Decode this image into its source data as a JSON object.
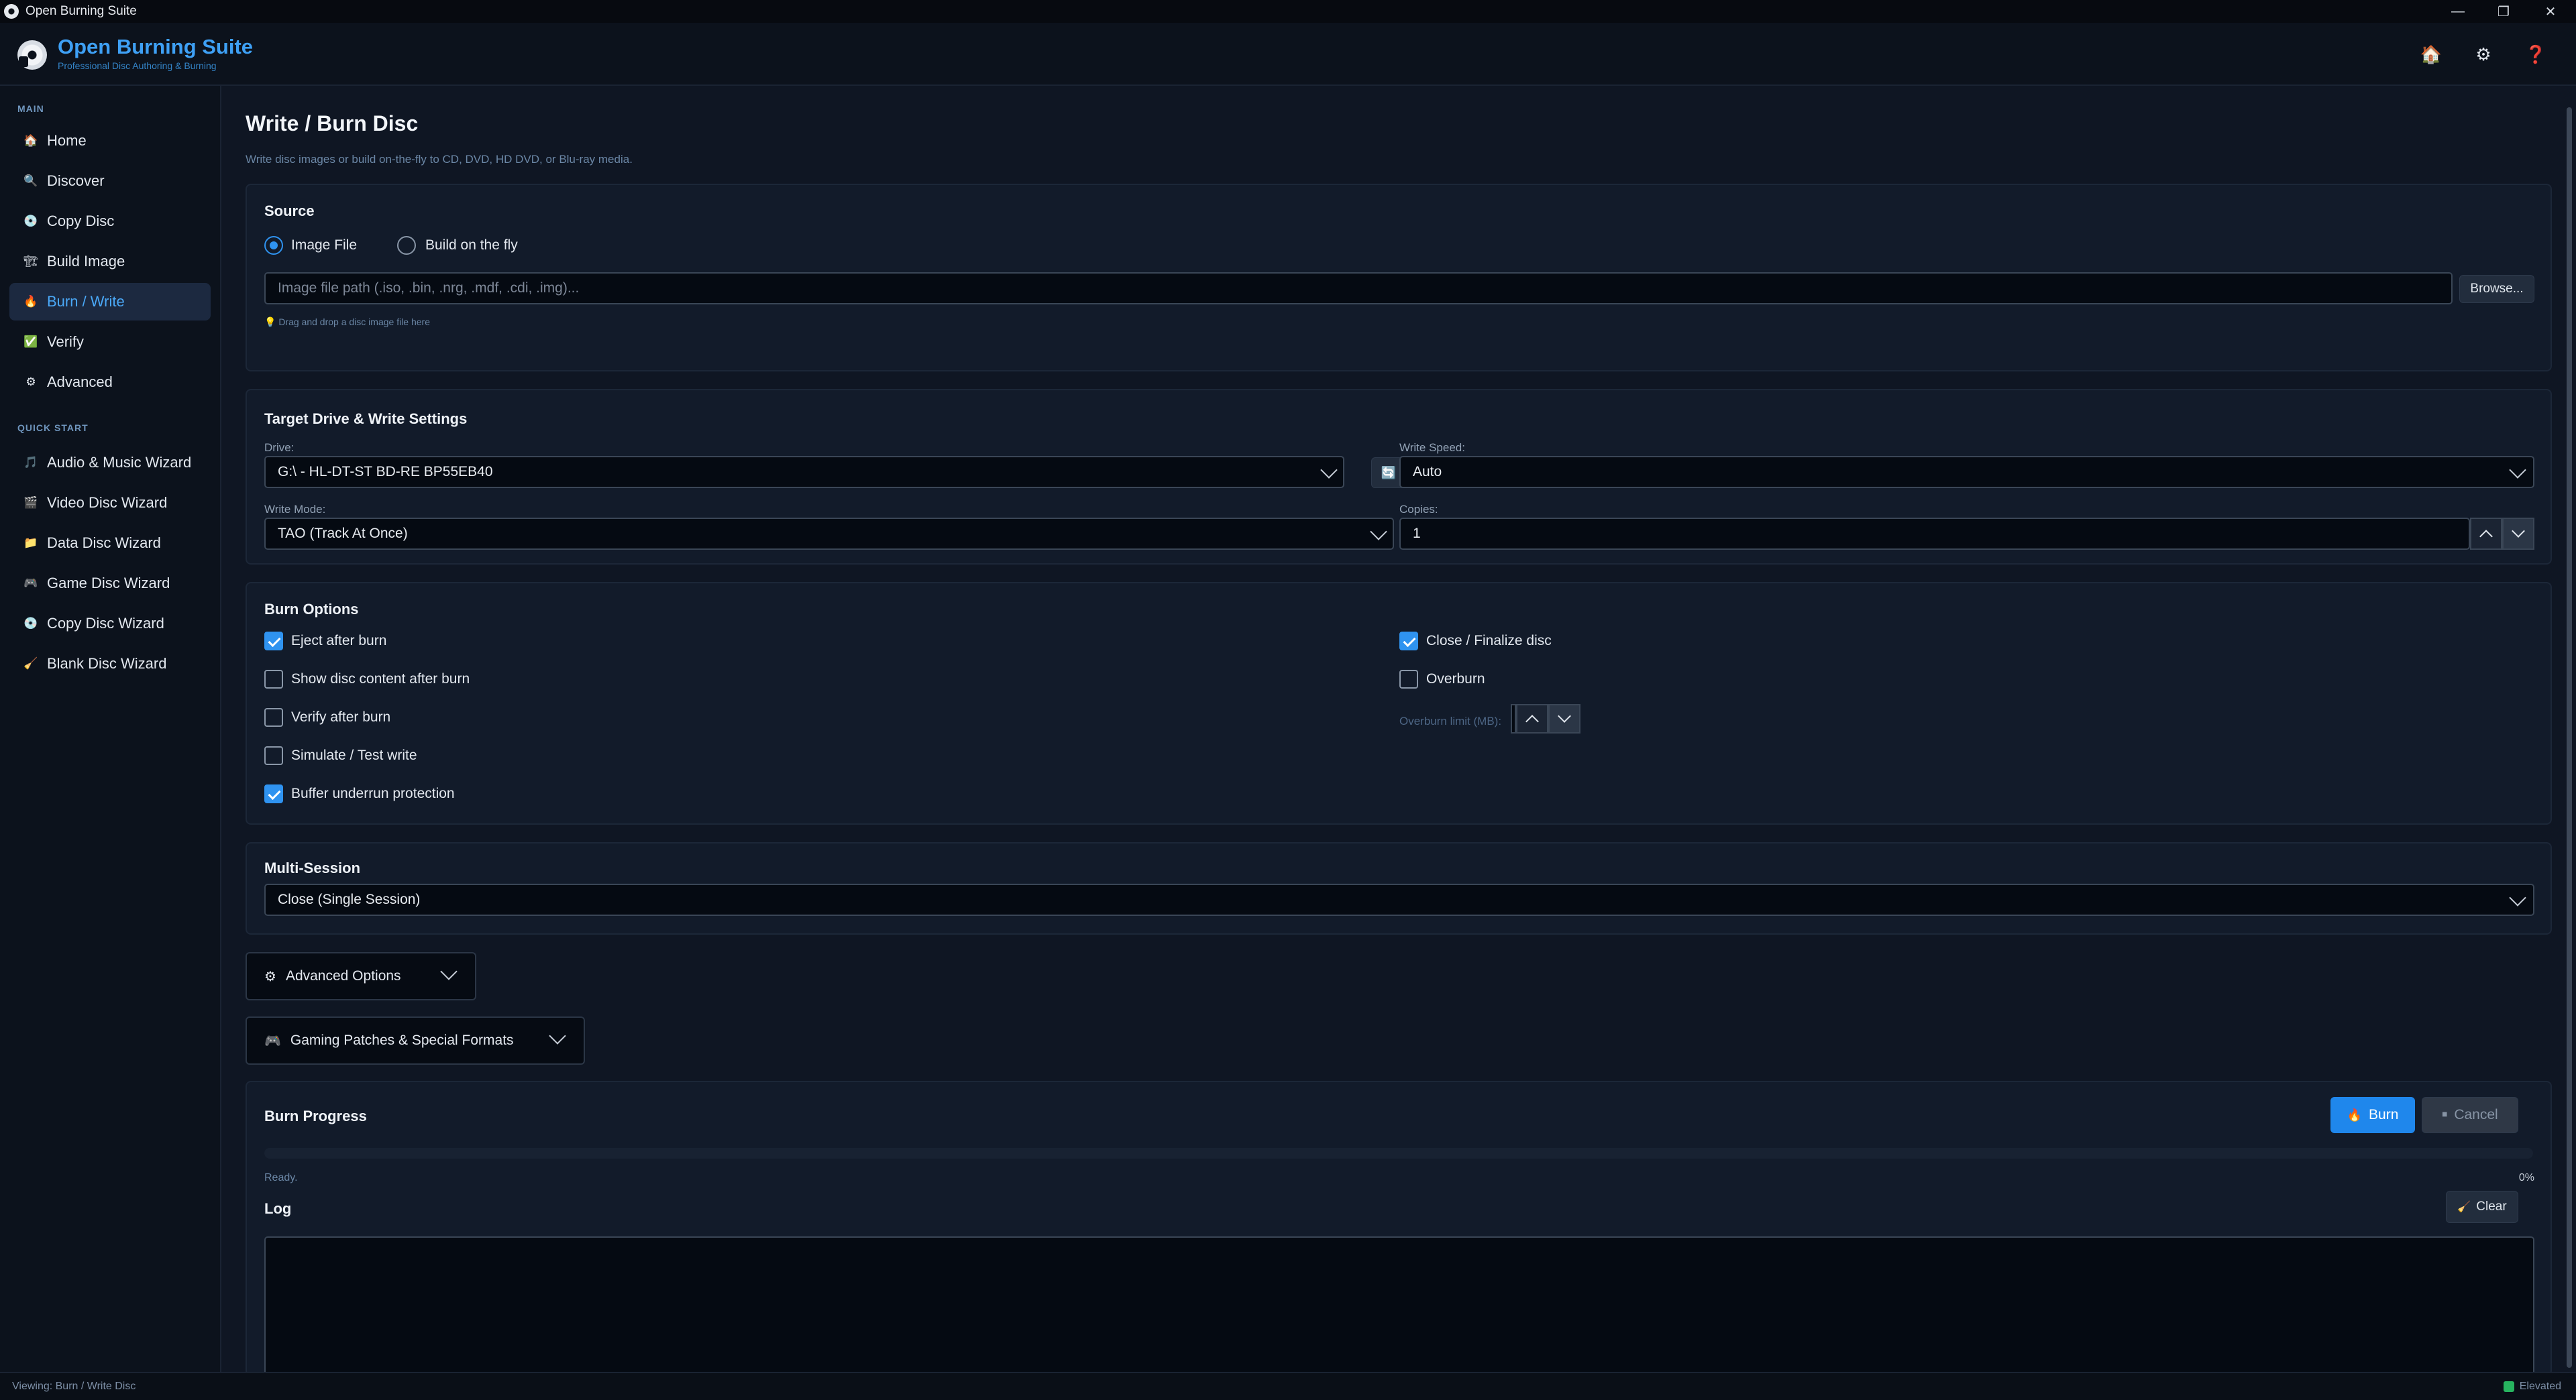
{
  "window": {
    "title": "Open Burning Suite",
    "minimize": "—",
    "maximize": "❐",
    "close": "✕"
  },
  "header": {
    "app_title": "Open Burning Suite",
    "subtitle": "Professional Disc Authoring & Burning",
    "home_icon": "🏠",
    "settings_icon": "⚙",
    "help_icon": "❓"
  },
  "sidebar": {
    "main_label": "MAIN",
    "main_items": [
      {
        "label": "Home",
        "icon": "🏠"
      },
      {
        "label": "Discover",
        "icon": "🔍"
      },
      {
        "label": "Copy Disc",
        "icon": "💿"
      },
      {
        "label": "Build Image",
        "icon": "🏗"
      },
      {
        "label": "Burn / Write",
        "icon": "🔥"
      },
      {
        "label": "Verify",
        "icon": "✅"
      },
      {
        "label": "Advanced",
        "icon": "⚙"
      }
    ],
    "quick_label": "QUICK START",
    "quick_items": [
      {
        "label": "Audio & Music Wizard",
        "icon": "🎵"
      },
      {
        "label": "Video Disc Wizard",
        "icon": "🎬"
      },
      {
        "label": "Data Disc Wizard",
        "icon": "📁"
      },
      {
        "label": "Game Disc Wizard",
        "icon": "🎮"
      },
      {
        "label": "Copy Disc Wizard",
        "icon": "💿"
      },
      {
        "label": "Blank Disc Wizard",
        "icon": "🧹"
      }
    ]
  },
  "page": {
    "title": "Write / Burn Disc",
    "subtitle": "Write disc images or build on-the-fly to CD, DVD, HD DVD, or Blu-ray media."
  },
  "source": {
    "title": "Source",
    "option_image": "Image File",
    "option_fly": "Build on the fly",
    "path_placeholder": "Image file path (.iso, .bin, .nrg, .mdf, .cdi, .img)...",
    "browse": "Browse...",
    "hint": "💡 Drag and drop a disc image file here"
  },
  "target": {
    "title": "Target Drive & Write Settings",
    "drive_label": "Drive:",
    "drive_value": "G:\\ - HL-DT-ST BD-RE BP55EB40",
    "refresh_icon": "🔄",
    "speed_label": "Write Speed:",
    "speed_value": "Auto",
    "mode_label": "Write Mode:",
    "mode_value": "TAO (Track At Once)",
    "copies_label": "Copies:",
    "copies_value": "1"
  },
  "burn_options": {
    "title": "Burn Options",
    "eject": "Eject after burn",
    "show_content": "Show disc content after burn",
    "verify": "Verify after burn",
    "simulate": "Simulate / Test write",
    "buffer": "Buffer underrun protection",
    "finalize": "Close / Finalize disc",
    "overburn": "Overburn",
    "overburn_limit": "Overburn limit (MB):"
  },
  "multisession": {
    "title": "Multi-Session",
    "value": "Close (Single Session)"
  },
  "advanced": {
    "label": "Advanced Options",
    "icon": "⚙"
  },
  "gaming": {
    "label": "Gaming Patches & Special Formats",
    "icon": "🎮"
  },
  "progress": {
    "title": "Burn Progress",
    "burn": "Burn",
    "burn_icon": "🔥",
    "cancel": "Cancel",
    "cancel_icon": "⏹",
    "status": "Ready.",
    "percent_text": "0%",
    "percent": 0,
    "log_title": "Log",
    "clear": "Clear",
    "clear_icon": "🧹"
  },
  "statusbar": {
    "text": "Viewing: Burn / Write Disc",
    "elevated": "Elevated"
  }
}
